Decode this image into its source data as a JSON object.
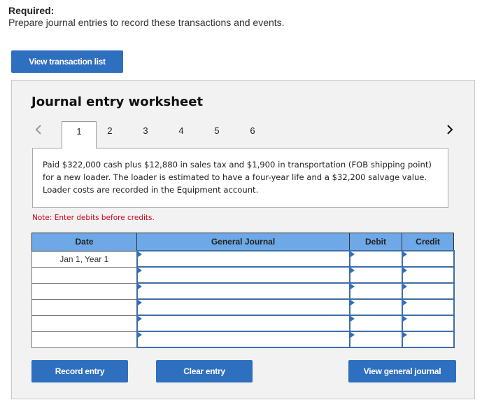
{
  "header": {
    "required_label": "Required:",
    "required_text": "Prepare journal entries to record these transactions and events."
  },
  "buttons": {
    "view_transaction_list": "View transaction list",
    "record_entry": "Record entry",
    "clear_entry": "Clear entry",
    "view_general_journal": "View general journal"
  },
  "worksheet": {
    "title": "Journal entry worksheet",
    "nav": {
      "prev_icon": "chevron-left-icon",
      "next_icon": "chevron-right-icon",
      "tabs": [
        {
          "label": "1",
          "active": true
        },
        {
          "label": "2",
          "active": false
        },
        {
          "label": "3",
          "active": false
        },
        {
          "label": "4",
          "active": false
        },
        {
          "label": "5",
          "active": false
        },
        {
          "label": "6",
          "active": false
        }
      ]
    },
    "description": "Paid $322,000 cash plus $12,880 in sales tax and $1,900 in transportation (FOB shipping point) for a new loader. The loader is estimated to have a four-year life and a $32,200 salvage value. Loader costs are recorded in the Equipment account.",
    "note": "Note: Enter debits before credits."
  },
  "journal_table": {
    "columns": [
      "Date",
      "General Journal",
      "Debit",
      "Credit"
    ],
    "rows": [
      {
        "date": "Jan 1, Year 1",
        "account": "",
        "debit": "",
        "credit": ""
      },
      {
        "date": "",
        "account": "",
        "debit": "",
        "credit": ""
      },
      {
        "date": "",
        "account": "",
        "debit": "",
        "credit": ""
      },
      {
        "date": "",
        "account": "",
        "debit": "",
        "credit": ""
      },
      {
        "date": "",
        "account": "",
        "debit": "",
        "credit": ""
      },
      {
        "date": "",
        "account": "",
        "debit": "",
        "credit": ""
      }
    ]
  },
  "colors": {
    "button_blue": "#2f6fbf",
    "header_blue": "#6ea8e6",
    "note_red": "#d0021b",
    "panel_bg": "#f2f2f2"
  }
}
